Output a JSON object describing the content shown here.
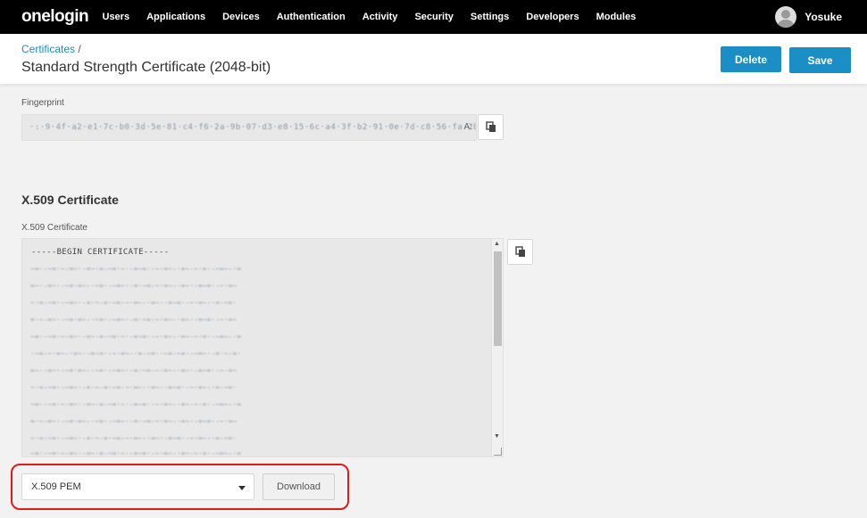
{
  "app": {
    "logo": "onelogin"
  },
  "nav": {
    "items": [
      "Users",
      "Applications",
      "Devices",
      "Authentication",
      "Activity",
      "Security",
      "Settings",
      "Developers",
      "Modules"
    ],
    "user_name": "Yosuke"
  },
  "header": {
    "breadcrumb_link": "Certificates",
    "breadcrumb_separator": "/",
    "title": "Standard Strength Certificate (2048-bit)",
    "delete_label": "Delete",
    "save_label": "Save"
  },
  "fingerprint": {
    "label": "Fingerprint",
    "value_end": "A:"
  },
  "x509": {
    "section_heading": "X.509 Certificate",
    "field_label": "X.509 Certificate",
    "begin_line": "-----BEGIN CERTIFICATE-----"
  },
  "download": {
    "format_selected": "X.509 PEM",
    "button_label": "Download"
  },
  "colors": {
    "accent": "#1a8ec5",
    "highlight": "#e01a1a",
    "topnav": "#000000"
  },
  "icons": {
    "copy": "copy-icon",
    "dropdown": "chevron-down-icon",
    "avatar": "user-avatar-icon"
  }
}
